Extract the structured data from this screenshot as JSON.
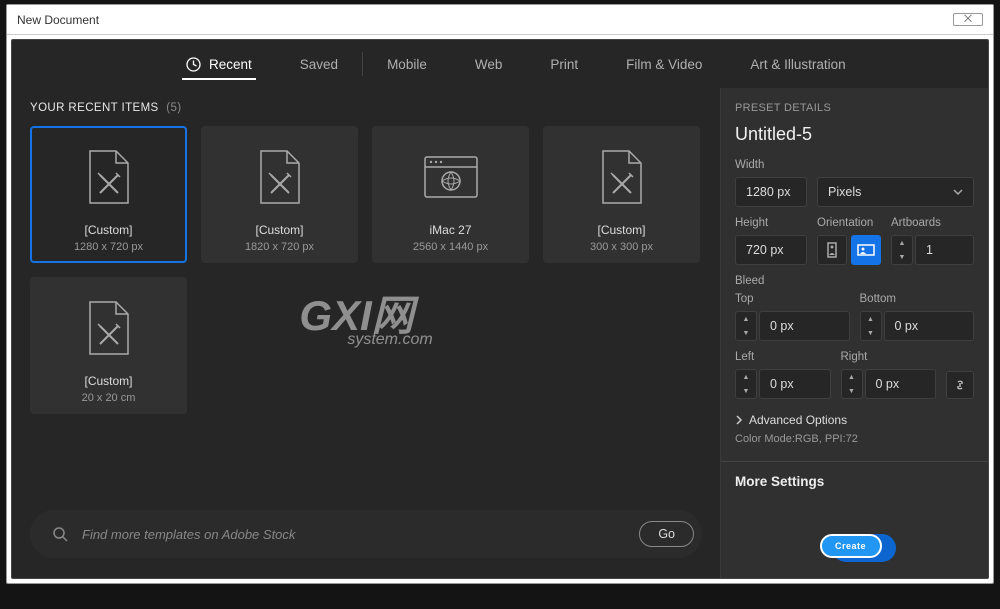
{
  "window": {
    "title": "New Document",
    "close": "⨉"
  },
  "tabs": [
    "Recent",
    "Saved",
    "Mobile",
    "Web",
    "Print",
    "Film & Video",
    "Art & Illustration"
  ],
  "activeTab": 0,
  "recent": {
    "label": "YOUR RECENT ITEMS",
    "count": "(5)",
    "items": [
      {
        "name": "[Custom]",
        "dims": "1280 x 720 px",
        "icon": "custom",
        "selected": true
      },
      {
        "name": "[Custom]",
        "dims": "1820 x 720 px",
        "icon": "custom"
      },
      {
        "name": "iMac 27",
        "dims": "2560 x 1440 px",
        "icon": "web"
      },
      {
        "name": "[Custom]",
        "dims": "300 x 300 px",
        "icon": "custom"
      },
      {
        "name": "[Custom]",
        "dims": "20 x 20 cm",
        "icon": "custom"
      }
    ]
  },
  "watermark": {
    "big": "GXI网",
    "small": "system.com"
  },
  "search": {
    "placeholder": "Find more templates on Adobe Stock",
    "go": "Go"
  },
  "preset": {
    "header": "PRESET DETAILS",
    "name": "Untitled-5",
    "widthLabel": "Width",
    "width": "1280 px",
    "units": "Pixels",
    "heightLabel": "Height",
    "height": "720 px",
    "orientationLabel": "Orientation",
    "artboardsLabel": "Artboards",
    "artboards": "1",
    "bleedLabel": "Bleed",
    "topLabel": "Top",
    "top": "0 px",
    "bottomLabel": "Bottom",
    "bottom": "0 px",
    "leftLabel": "Left",
    "left": "0 px",
    "rightLabel": "Right",
    "right": "0 px",
    "advanced": "Advanced Options",
    "colorMode": "Color Mode:RGB, PPI:72",
    "more": "More Settings",
    "create": "Create"
  }
}
